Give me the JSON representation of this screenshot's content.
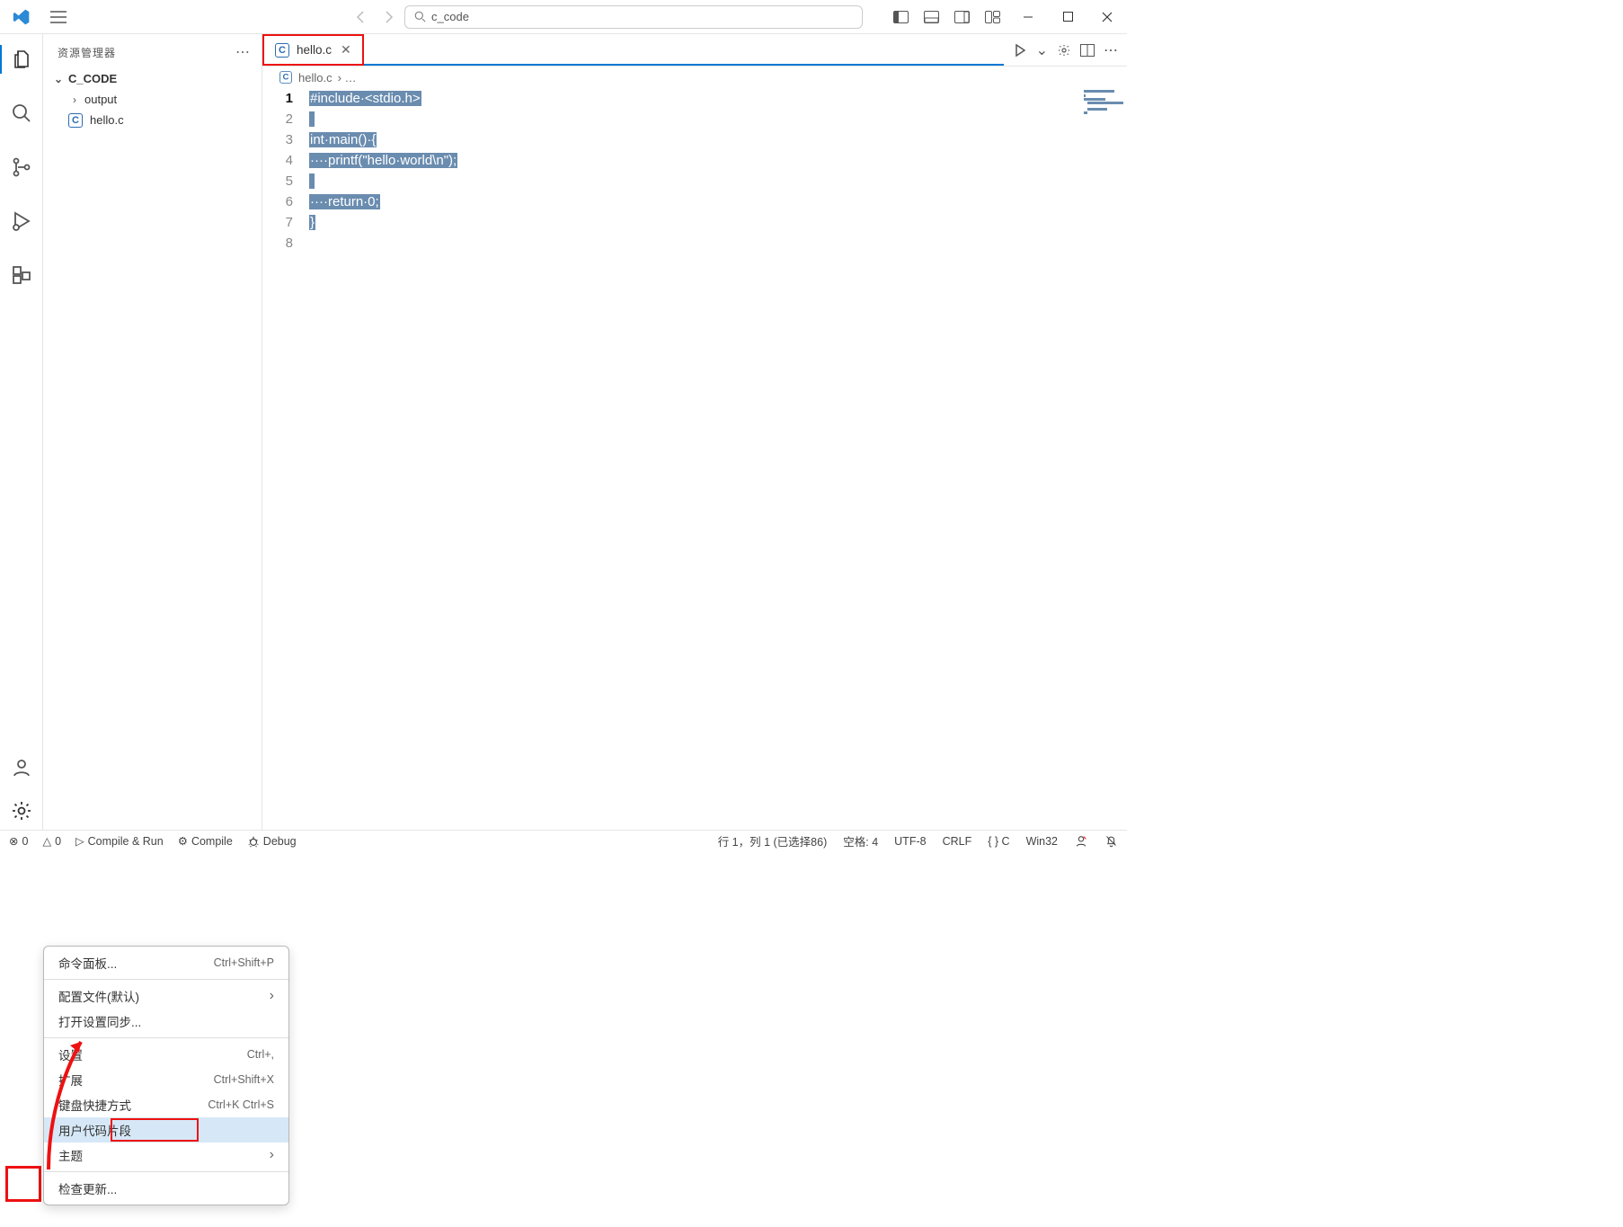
{
  "title_search": "c_code",
  "sidebar": {
    "header": "资源管理器",
    "project": "C_CODE",
    "items": [
      {
        "kind": "folder",
        "chev": "›",
        "label": "output"
      },
      {
        "kind": "cfile",
        "label": "hello.c"
      }
    ]
  },
  "tab": {
    "icon": "C",
    "label": "hello.c"
  },
  "breadcrumb": {
    "icon": "C",
    "file": "hello.c",
    "rest": "› …"
  },
  "code": {
    "lines": [
      "#include·<stdio.h>",
      "",
      "int·main()·{",
      "····printf(\"hello·world\\n\");",
      "",
      "····return·0;",
      "}",
      ""
    ],
    "current_line": 1
  },
  "ctx": {
    "items": [
      {
        "label": "命令面板...",
        "shortcut": "Ctrl+Shift+P"
      },
      {
        "sep": true
      },
      {
        "label": "配置文件(默认)",
        "submenu": true
      },
      {
        "label": "打开设置同步..."
      },
      {
        "sep": true
      },
      {
        "label": "设置",
        "shortcut": "Ctrl+,"
      },
      {
        "label": "扩展",
        "shortcut": "Ctrl+Shift+X"
      },
      {
        "label": "键盘快捷方式",
        "shortcut": "Ctrl+K Ctrl+S"
      },
      {
        "label": "用户代码片段",
        "selected": true
      },
      {
        "label": "主题",
        "submenu": true
      },
      {
        "sep": true
      },
      {
        "label": "检查更新..."
      }
    ]
  },
  "status": {
    "left": [
      {
        "icon": "⊗",
        "text": "0"
      },
      {
        "icon": "△",
        "text": "0"
      },
      {
        "icon": "▷",
        "text": "Compile & Run"
      },
      {
        "icon": "⚙",
        "text": "Compile"
      },
      {
        "icon": "�除",
        "text": "Debug",
        "real_icon": "bug"
      }
    ],
    "right": [
      "行 1，列 1 (已选择86)",
      "空格: 4",
      "UTF-8",
      "CRLF",
      "{ }  C",
      "Win32"
    ]
  }
}
